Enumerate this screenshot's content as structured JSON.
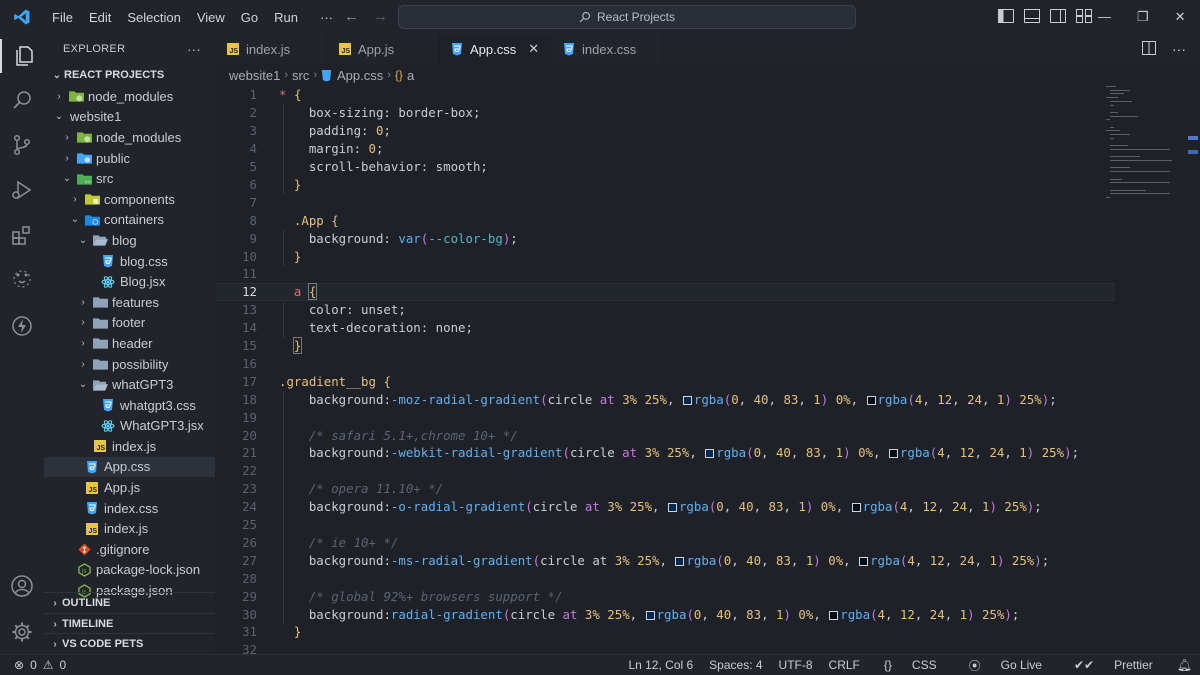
{
  "titlebar": {
    "menu": [
      "File",
      "Edit",
      "Selection",
      "View",
      "Go",
      "Run"
    ],
    "more": "···",
    "search": "React Projects"
  },
  "sidebar": {
    "title": "EXPLORER",
    "more": "···",
    "root": "REACT PROJECTS",
    "tree": [
      {
        "label": "node_modules",
        "depth": 1,
        "kind": "folder-node",
        "chev": "›"
      },
      {
        "label": "website1",
        "depth": 1,
        "kind": "none",
        "chev": "⌄"
      },
      {
        "label": "node_modules",
        "depth": 2,
        "kind": "folder-node",
        "chev": "›"
      },
      {
        "label": "public",
        "depth": 2,
        "kind": "folder-public",
        "chev": "›"
      },
      {
        "label": "src",
        "depth": 2,
        "kind": "folder-src",
        "chev": "⌄"
      },
      {
        "label": "components",
        "depth": 3,
        "kind": "folder-comp",
        "chev": "›"
      },
      {
        "label": "containers",
        "depth": 3,
        "kind": "folder-cont",
        "chev": "⌄"
      },
      {
        "label": "blog",
        "depth": 4,
        "kind": "folder-open",
        "chev": "⌄"
      },
      {
        "label": "blog.css",
        "depth": 5,
        "kind": "css",
        "chev": ""
      },
      {
        "label": "Blog.jsx",
        "depth": 5,
        "kind": "react",
        "chev": ""
      },
      {
        "label": "features",
        "depth": 4,
        "kind": "folder",
        "chev": "›"
      },
      {
        "label": "footer",
        "depth": 4,
        "kind": "folder",
        "chev": "›"
      },
      {
        "label": "header",
        "depth": 4,
        "kind": "folder",
        "chev": "›"
      },
      {
        "label": "possibility",
        "depth": 4,
        "kind": "folder",
        "chev": "›"
      },
      {
        "label": "whatGPT3",
        "depth": 4,
        "kind": "folder-open",
        "chev": "⌄"
      },
      {
        "label": "whatgpt3.css",
        "depth": 5,
        "kind": "css",
        "chev": ""
      },
      {
        "label": "WhatGPT3.jsx",
        "depth": 5,
        "kind": "react",
        "chev": ""
      },
      {
        "label": "index.js",
        "depth": 4,
        "kind": "js",
        "chev": ""
      },
      {
        "label": "App.css",
        "depth": 3,
        "kind": "css",
        "chev": "",
        "selected": true
      },
      {
        "label": "App.js",
        "depth": 3,
        "kind": "js",
        "chev": ""
      },
      {
        "label": "index.css",
        "depth": 3,
        "kind": "css",
        "chev": ""
      },
      {
        "label": "index.js",
        "depth": 3,
        "kind": "js",
        "chev": ""
      },
      {
        "label": ".gitignore",
        "depth": 2,
        "kind": "git",
        "chev": ""
      },
      {
        "label": "package-lock.json",
        "depth": 2,
        "kind": "npm",
        "chev": ""
      },
      {
        "label": "package.json",
        "depth": 2,
        "kind": "npm",
        "chev": ""
      }
    ],
    "outline": "OUTLINE",
    "timeline": "TIMELINE",
    "pets": "VS CODE PETS"
  },
  "tabs": [
    {
      "label": "index.js",
      "kind": "js"
    },
    {
      "label": "App.js",
      "kind": "js"
    },
    {
      "label": "App.css",
      "kind": "css",
      "active": true
    },
    {
      "label": "index.css",
      "kind": "css"
    }
  ],
  "breadcrumb": {
    "parts": [
      "website1",
      "src",
      "App.css",
      "a"
    ]
  },
  "editor": {
    "current_line": 12,
    "swatch_colors": {
      "c1": "#002853",
      "c2": "#040c18"
    }
  },
  "status": {
    "errors": "0",
    "warnings": "0",
    "position": "Ln 12, Col 6",
    "spaces": "Spaces: 4",
    "encoding": "UTF-8",
    "eol": "CRLF",
    "language": "CSS",
    "golive": "Go Live",
    "prettier": "Prettier"
  }
}
